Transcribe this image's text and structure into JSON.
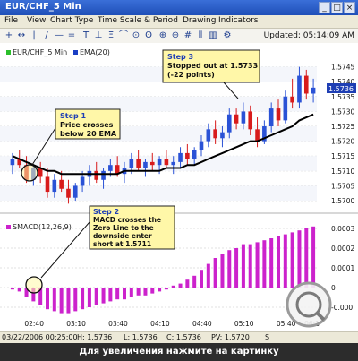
{
  "window": {
    "title": "EUR/CHF_5 Min"
  },
  "menu": [
    "File",
    "View",
    "Chart Type",
    "Time Scale & Period",
    "Drawing",
    "Indicators"
  ],
  "toolbar": {
    "updated": "Updated: 05:14:09 AM"
  },
  "legend": {
    "series1": "EUR/CHF_5 Min",
    "series2": "EMA(20)",
    "macd": "SMACD(12,26,9)"
  },
  "price_axis": {
    "ticks": [
      "1.5745",
      "1.5740",
      "1.5735",
      "1.5730",
      "1.5725",
      "1.5720",
      "1.5715",
      "1.5710",
      "1.5705",
      "1.5700"
    ],
    "last_price": "1.5736"
  },
  "macd_axis": {
    "ticks": [
      "0.0003",
      "0.0002",
      "0.0001",
      "0",
      "-0.000"
    ]
  },
  "time_axis": {
    "ticks": [
      "02:40",
      "03:10",
      "03:40",
      "04:10",
      "04:40",
      "05:10",
      "05:40",
      "06:1"
    ]
  },
  "annotations": {
    "step1": {
      "title": "Step 1",
      "text": [
        "Price crosses",
        "below 20 EMA"
      ]
    },
    "step2": {
      "title": "Step 2",
      "text": [
        "MACD crosses the",
        "Zero Line to the",
        "downside enter",
        "short at 1.5711"
      ]
    },
    "step3": {
      "title": "Step 3",
      "text": [
        "Stopped out at 1.5733",
        "(-22 points)"
      ]
    }
  },
  "status": {
    "date": "03/22/2006 00:25:00",
    "high": "H: 1.5736",
    "low": "L: 1.5736",
    "close": "C: 1.5736",
    "pv": "PV: 1.5720",
    "s": "S"
  },
  "caption": "Для увеличения нажмите на картинку",
  "colors": {
    "up": "#2a52d6",
    "down": "#d81b1b",
    "ema": "#000000",
    "macd": "#cc22cc",
    "callout": "#fff7a8"
  },
  "icons": [
    "zoom-icon"
  ],
  "chart_data": {
    "type": "bar",
    "price_ylim": [
      1.5697,
      1.575
    ],
    "candles": [
      [
        1.5712,
        1.5716,
        1.5709,
        1.5714
      ],
      [
        1.5714,
        1.5717,
        1.5711,
        1.5712
      ],
      [
        1.5712,
        1.5715,
        1.5706,
        1.5707
      ],
      [
        1.5707,
        1.5712,
        1.5705,
        1.5711
      ],
      [
        1.5711,
        1.5713,
        1.5706,
        1.5708
      ],
      [
        1.5708,
        1.5711,
        1.5701,
        1.5703
      ],
      [
        1.5703,
        1.5709,
        1.5701,
        1.5707
      ],
      [
        1.5707,
        1.571,
        1.5703,
        1.5704
      ],
      [
        1.5704,
        1.5707,
        1.5699,
        1.5701
      ],
      [
        1.5701,
        1.5706,
        1.57,
        1.5705
      ],
      [
        1.5705,
        1.571,
        1.5703,
        1.5708
      ],
      [
        1.5708,
        1.5712,
        1.5705,
        1.571
      ],
      [
        1.571,
        1.5713,
        1.5706,
        1.5707
      ],
      [
        1.5707,
        1.5711,
        1.5704,
        1.571
      ],
      [
        1.571,
        1.5714,
        1.5708,
        1.5712
      ],
      [
        1.5712,
        1.5715,
        1.5708,
        1.5709
      ],
      [
        1.5709,
        1.5713,
        1.5706,
        1.5711
      ],
      [
        1.5711,
        1.5716,
        1.5709,
        1.5714
      ],
      [
        1.5714,
        1.5717,
        1.571,
        1.5711
      ],
      [
        1.5711,
        1.5714,
        1.5708,
        1.5713
      ],
      [
        1.5713,
        1.5716,
        1.571,
        1.5712
      ],
      [
        1.5712,
        1.5715,
        1.5709,
        1.5714
      ],
      [
        1.5714,
        1.5717,
        1.5711,
        1.5712
      ],
      [
        1.5712,
        1.5715,
        1.5709,
        1.5713
      ],
      [
        1.5713,
        1.5718,
        1.5711,
        1.5716
      ],
      [
        1.5716,
        1.5719,
        1.5712,
        1.5714
      ],
      [
        1.5714,
        1.5718,
        1.5712,
        1.5717
      ],
      [
        1.5717,
        1.5722,
        1.5715,
        1.572
      ],
      [
        1.572,
        1.5726,
        1.5718,
        1.5724
      ],
      [
        1.5724,
        1.5727,
        1.5719,
        1.5721
      ],
      [
        1.5721,
        1.5725,
        1.5718,
        1.5723
      ],
      [
        1.5723,
        1.5731,
        1.5721,
        1.5729
      ],
      [
        1.5729,
        1.5731,
        1.5724,
        1.5726
      ],
      [
        1.5726,
        1.5733,
        1.5724,
        1.573
      ],
      [
        1.573,
        1.5732,
        1.5722,
        1.5724
      ],
      [
        1.5724,
        1.5728,
        1.5718,
        1.572
      ],
      [
        1.572,
        1.5727,
        1.5719,
        1.5725
      ],
      [
        1.5725,
        1.5733,
        1.5723,
        1.5731
      ],
      [
        1.5731,
        1.5734,
        1.5725,
        1.5727
      ],
      [
        1.5727,
        1.5737,
        1.5726,
        1.5735
      ],
      [
        1.5735,
        1.5741,
        1.5731,
        1.5733
      ],
      [
        1.5733,
        1.5745,
        1.5731,
        1.5742
      ],
      [
        1.5742,
        1.5744,
        1.5734,
        1.5736
      ],
      [
        1.5736,
        1.5741,
        1.5733,
        1.5738
      ]
    ],
    "ema": [
      1.5715,
      1.5714,
      1.5713,
      1.5712,
      1.5711,
      1.571,
      1.571,
      1.5709,
      1.5709,
      1.5709,
      1.5709,
      1.5709,
      1.5709,
      1.5709,
      1.5709,
      1.5709,
      1.571,
      1.571,
      1.571,
      1.571,
      1.571,
      1.571,
      1.5711,
      1.5711,
      1.5711,
      1.5712,
      1.5712,
      1.5713,
      1.5714,
      1.5715,
      1.5716,
      1.5717,
      1.5718,
      1.5719,
      1.572,
      1.572,
      1.5721,
      1.5722,
      1.5723,
      1.5724,
      1.5725,
      1.5727,
      1.5728,
      1.5729
    ],
    "macd_ylim": [
      -0.00015,
      0.00035
    ],
    "macd": [
      -1e-05,
      -2e-05,
      -5e-05,
      -7e-05,
      -9e-05,
      -0.00011,
      -0.00012,
      -0.00013,
      -0.00013,
      -0.00012,
      -0.00011,
      -0.0001,
      -9e-05,
      -8e-05,
      -7e-05,
      -6e-05,
      -6e-05,
      -5e-05,
      -4e-05,
      -4e-05,
      -3e-05,
      -2e-05,
      -1e-05,
      1e-05,
      2e-05,
      4e-05,
      6e-05,
      9e-05,
      0.00012,
      0.00015,
      0.00017,
      0.00019,
      0.0002,
      0.00022,
      0.00022,
      0.00023,
      0.00024,
      0.00025,
      0.00026,
      0.00027,
      0.00028,
      0.00029,
      0.0003,
      0.00031
    ]
  }
}
